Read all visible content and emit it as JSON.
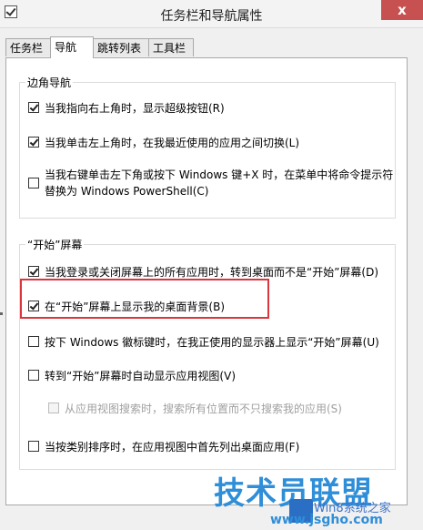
{
  "window": {
    "title": "任务栏和导航属性",
    "close": "x"
  },
  "tabs": [
    {
      "label": "任务栏"
    },
    {
      "label": "导航"
    },
    {
      "label": "跳转列表"
    },
    {
      "label": "工具栏"
    }
  ],
  "corner_group": {
    "label": "边角导航",
    "options": [
      {
        "label": "当我指向右上角时，显示超级按钮(R)",
        "checked": true
      },
      {
        "label": "当我单击左上角时，在我最近使用的应用之间切换(L)",
        "checked": true
      },
      {
        "label_line1": "当我右键单击左下角或按下 Windows 键+X 时，在菜单中将命令提示符",
        "label_line2": "替换为 Windows PowerShell(C)",
        "checked": false
      }
    ]
  },
  "start_group": {
    "label": "“开始”屏幕",
    "options": [
      {
        "label": "当我登录或关闭屏幕上的所有应用时，转到桌面而不是“开始”屏幕(D)",
        "checked": true
      },
      {
        "label": "在“开始”屏幕上显示我的桌面背景(B)",
        "checked": true
      },
      {
        "label": "按下 Windows 徽标键时，在我正使用的显示器上显示“开始”屏幕(U)",
        "checked": false
      },
      {
        "label": "转到“开始”屏幕时自动显示应用视图(V)",
        "checked": false
      },
      {
        "label": "从应用视图搜索时，搜索所有位置而不只搜索我的应用(S)",
        "checked": false,
        "disabled": true
      },
      {
        "label": "当按类别排序时，在应用视图中首先列出桌面应用(F)",
        "checked": false
      }
    ]
  },
  "watermark": {
    "brand": "技术员联盟",
    "sub": "Win8系统之家",
    "url": "www.jsgho.com"
  }
}
